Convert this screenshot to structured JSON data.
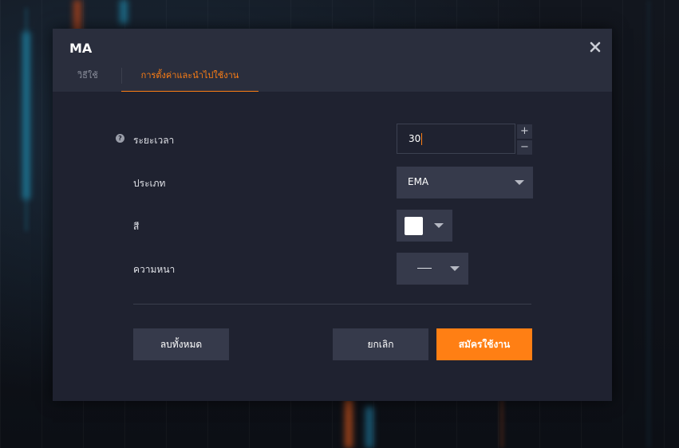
{
  "dialog": {
    "title": "MA",
    "tabs": [
      {
        "label": "วิธีใช้"
      },
      {
        "label": "การตั้งค่าและนำไปใช้งาน"
      }
    ],
    "fields": {
      "period": {
        "label": "ระยะเวลา",
        "value": "30",
        "increment": "+",
        "decrement": "−"
      },
      "type": {
        "label": "ประเภท",
        "value": "EMA"
      },
      "color": {
        "label": "สี",
        "swatch_color": "#ffffff"
      },
      "thickness": {
        "label": "ความหนา"
      }
    },
    "buttons": {
      "clear": "ลบทั้งหมด",
      "cancel": "ยกเลิก",
      "apply": "สมัครใช้งาน"
    }
  },
  "colors": {
    "accent": "#ff7f14",
    "panel": "#1f2230",
    "header": "#2a2e3d",
    "control": "#363a4b"
  }
}
